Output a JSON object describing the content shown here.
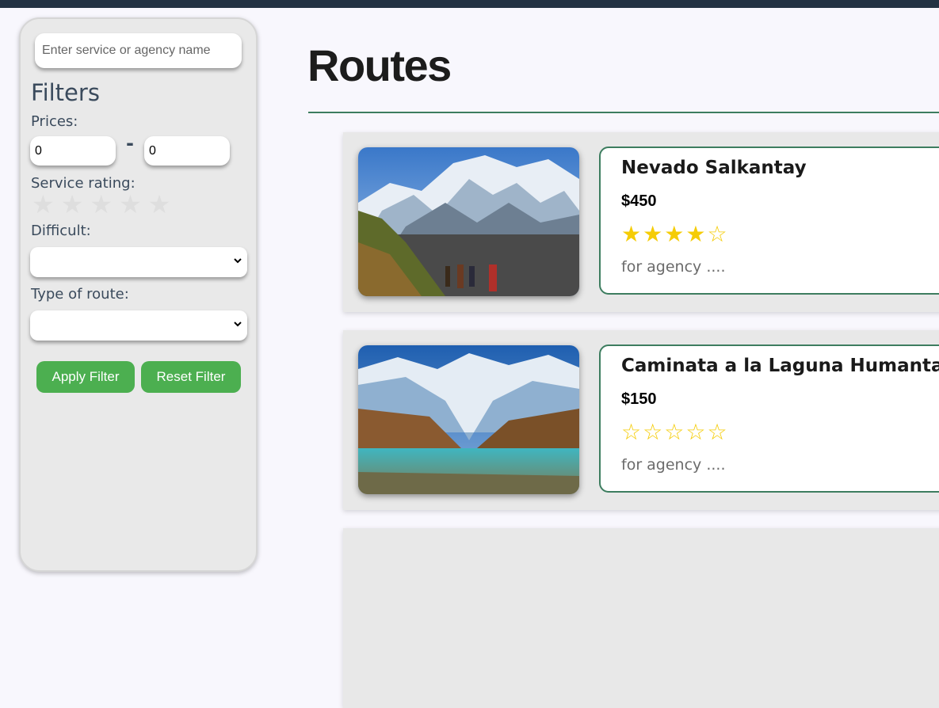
{
  "search": {
    "placeholder": "Enter service or agency name"
  },
  "filters": {
    "title": "Filters",
    "prices_label": "Prices:",
    "price_min": "0",
    "price_max": "0",
    "price_separator": "-",
    "rating_label": "Service rating:",
    "rating_stars": [
      "★",
      "★",
      "★",
      "★",
      "★"
    ],
    "difficulty_label": "Difficult:",
    "difficulty_value": "",
    "route_type_label": "Type of route:",
    "route_type_value": "",
    "apply_label": "Apply Filter",
    "reset_label": "Reset Filter"
  },
  "main": {
    "title": "Routes",
    "routes": [
      {
        "name": "Nevado Salkantay",
        "price": "$450",
        "rating": 4,
        "stars": [
          "★",
          "★",
          "★",
          "★",
          "☆"
        ],
        "agency": "for agency ...."
      },
      {
        "name": "Caminata a la Laguna Humantay",
        "price": "$150",
        "rating": 0,
        "stars": [
          "☆",
          "☆",
          "☆",
          "☆",
          "☆"
        ],
        "agency": "for agency ...."
      }
    ]
  },
  "colors": {
    "accent_green": "#4caf50",
    "border_green": "#3d7d5f",
    "star_yellow": "#f5cc06",
    "topbar": "#233243"
  }
}
